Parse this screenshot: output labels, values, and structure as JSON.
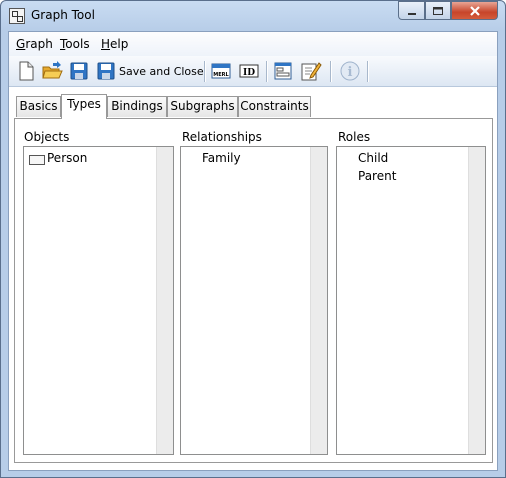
{
  "window": {
    "title": "Graph Tool",
    "app_icon": "graph-app-icon"
  },
  "title_controls": {
    "minimize": "minimize-icon",
    "maximize": "maximize-icon",
    "close": "close-icon"
  },
  "menu": [
    {
      "label": "Graph",
      "accel": "G",
      "rest": "raph"
    },
    {
      "label": "Tools",
      "accel": "T",
      "rest": "ools"
    },
    {
      "label": "Help",
      "accel": "H",
      "rest": "elp"
    }
  ],
  "toolbar": {
    "save_close_label": "Save and Close",
    "icons": [
      "new-document-icon",
      "open-folder-icon",
      "save-icon",
      "save-and-close-icon",
      "merl-icon",
      "id-icon",
      "form-icon",
      "edit-icon",
      "info-icon"
    ]
  },
  "tabs": [
    {
      "label": "Basics",
      "active": false
    },
    {
      "label": "Types",
      "active": true
    },
    {
      "label": "Bindings",
      "active": false
    },
    {
      "label": "Subgraphs",
      "active": false
    },
    {
      "label": "Constraints",
      "active": false
    }
  ],
  "types_panel": {
    "objects": {
      "label": "Objects",
      "items": [
        "Person"
      ]
    },
    "relationships": {
      "label": "Relationships",
      "items": [
        "Family"
      ]
    },
    "roles": {
      "label": "Roles",
      "items": [
        "Child",
        "Parent"
      ]
    }
  },
  "colors": {
    "accent": "#2f75c4",
    "window_frame": "#b7cde8",
    "close_button": "#c7452a"
  }
}
